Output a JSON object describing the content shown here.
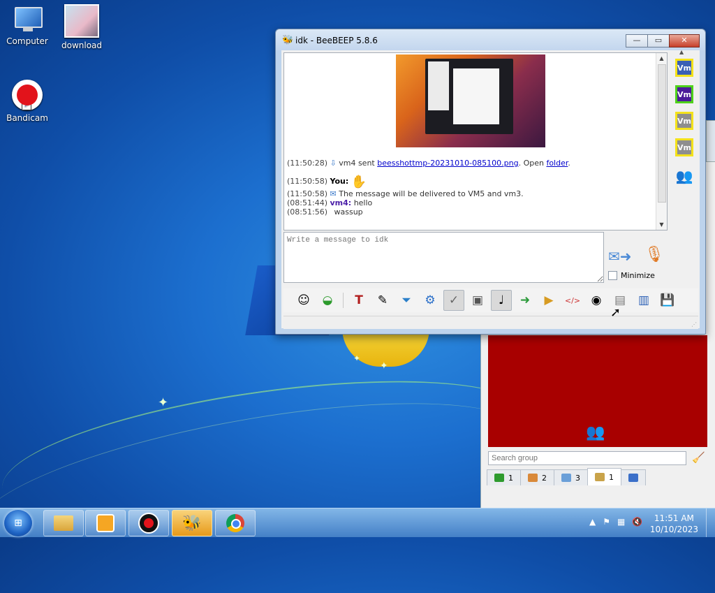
{
  "desktop": {
    "icons": [
      {
        "label": "Computer"
      },
      {
        "label": "download"
      },
      {
        "label": "Bandicam"
      }
    ]
  },
  "chat_window": {
    "title": "idk - BeeBEEP 5.8.6",
    "buttons": {
      "minimize": "—",
      "restore": "▭",
      "close": "✕"
    },
    "messages": {
      "m1": {
        "time": "(11:50:28)",
        "text_pre": "vm4 sent ",
        "link": "beesshottmp-20231010-085100.png",
        "text_mid": ". Open ",
        "link2": "folder",
        "text_post": "."
      },
      "m2": {
        "time": "(11:50:58)",
        "sender": "You:"
      },
      "m3": {
        "time": "(11:50:58)",
        "text": "The message will be delivered to VM5 and vm3."
      },
      "m4": {
        "time": "(08:51:44)",
        "sender": "vm4:",
        "text": "hello"
      },
      "m5": {
        "time": "(08:51:56)",
        "text": "wassup"
      }
    },
    "input": {
      "placeholder": "Write a message to idk"
    },
    "minimize_label": "Minimize",
    "users": [
      "Vm",
      "Vm",
      "Vm",
      "Vm"
    ],
    "toolbar_icons": [
      "emoticon-icon",
      "bullet-icon",
      "font-icon",
      "color-icon",
      "filter-icon",
      "settings-icon",
      "spellcheck-icon",
      "dictionary-icon",
      "compact-icon",
      "send-file-icon",
      "send-folder-icon",
      "html-icon",
      "screenshot-icon",
      "history-icon",
      "save-icon",
      "save-as-icon"
    ]
  },
  "main_window": {
    "search": {
      "placeholder": "Search group"
    },
    "tabs": [
      {
        "count": "1"
      },
      {
        "count": "2"
      },
      {
        "count": "3"
      },
      {
        "count": "1"
      }
    ]
  },
  "taskbar": {
    "clock": {
      "time": "11:51 AM",
      "date": "10/10/2023"
    }
  },
  "colors": {
    "accent_red": "#a80000",
    "link": "#0000cc",
    "vm4_name": "#4b1fa8"
  }
}
